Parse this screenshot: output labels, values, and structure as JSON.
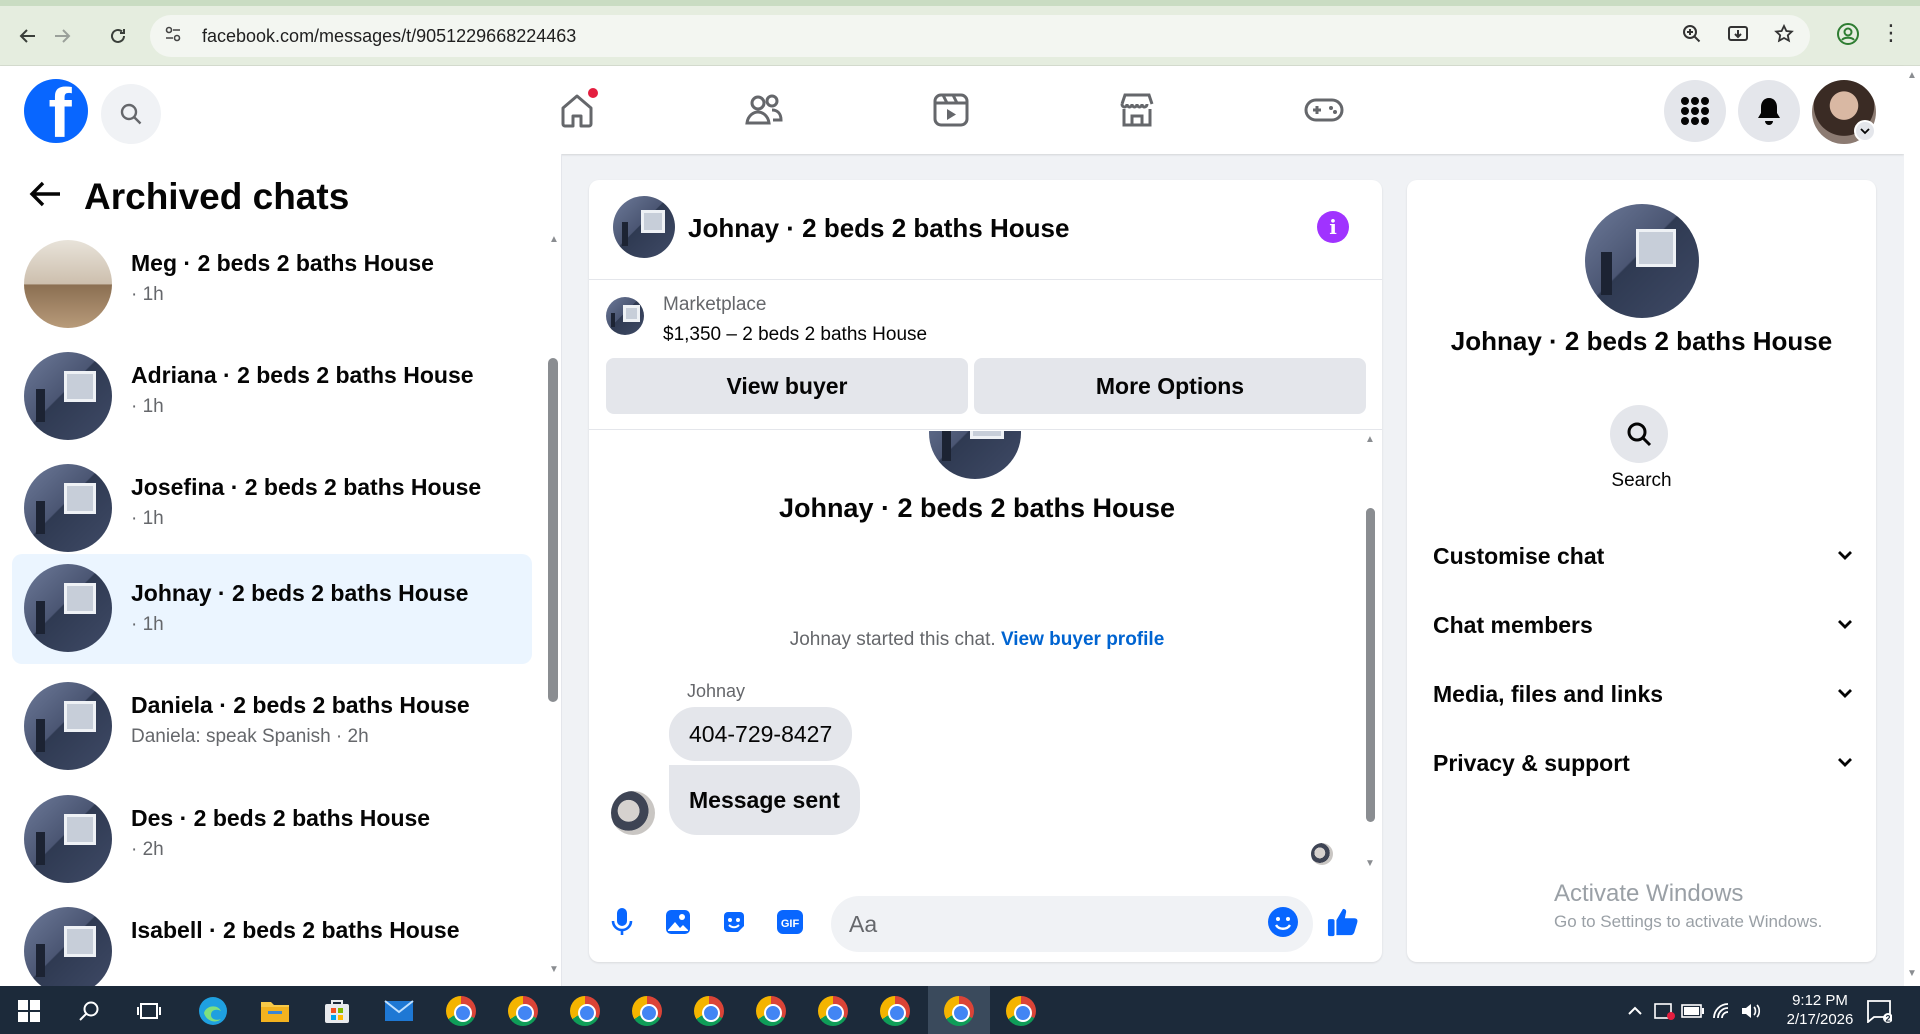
{
  "browser": {
    "url": "facebook.com/messages/t/9051229668224463"
  },
  "header": {
    "logo_letter": "f"
  },
  "left": {
    "title": "Archived chats",
    "chats": [
      {
        "name": "Meg · 2 beds 2 baths House",
        "sub": "· 1h"
      },
      {
        "name": "Adriana · 2 beds 2 baths House",
        "sub": "· 1h"
      },
      {
        "name": "Josefina · 2 beds 2 baths House",
        "sub": "· 1h"
      },
      {
        "name": "Johnay · 2 beds 2 baths House",
        "sub": "· 1h"
      },
      {
        "name": "Daniela · 2 beds 2 baths House",
        "sub": "Daniela: speak Spanish · 2h"
      },
      {
        "name": "Des · 2 beds 2 baths House",
        "sub": "· 2h"
      },
      {
        "name": "Isabell · 2 beds 2 baths House",
        "sub": ""
      }
    ]
  },
  "conversation": {
    "title": "Johnay · 2 beds 2 baths House",
    "marketplace_label": "Marketplace",
    "listing": "$1,350 – 2 beds 2 baths House",
    "view_buyer": "View buyer",
    "more_options": "More Options",
    "intro_title": "Johnay · 2 beds 2 baths House",
    "started_text": "Johnay started this chat.",
    "view_buyer_profile": "View buyer profile",
    "sender": "Johnay",
    "messages": [
      "404-729-8427",
      "Message sent"
    ],
    "input_placeholder": "Aa"
  },
  "details": {
    "title": "Johnay · 2 beds 2 baths House",
    "search_label": "Search",
    "sections": [
      "Customise chat",
      "Chat members",
      "Media, files and links",
      "Privacy & support"
    ]
  },
  "watermark": {
    "line1": "Activate Windows",
    "line2": "Go to Settings to activate Windows."
  },
  "taskbar": {
    "time": "9:12 PM",
    "date": "2/17/2026"
  },
  "colors": {
    "fb_blue": "#0866ff",
    "link_blue": "#0064d1",
    "info_purple": "#a033ff",
    "active_chat_bg": "#ebf5ff",
    "notification_red": "#e41e3f"
  }
}
